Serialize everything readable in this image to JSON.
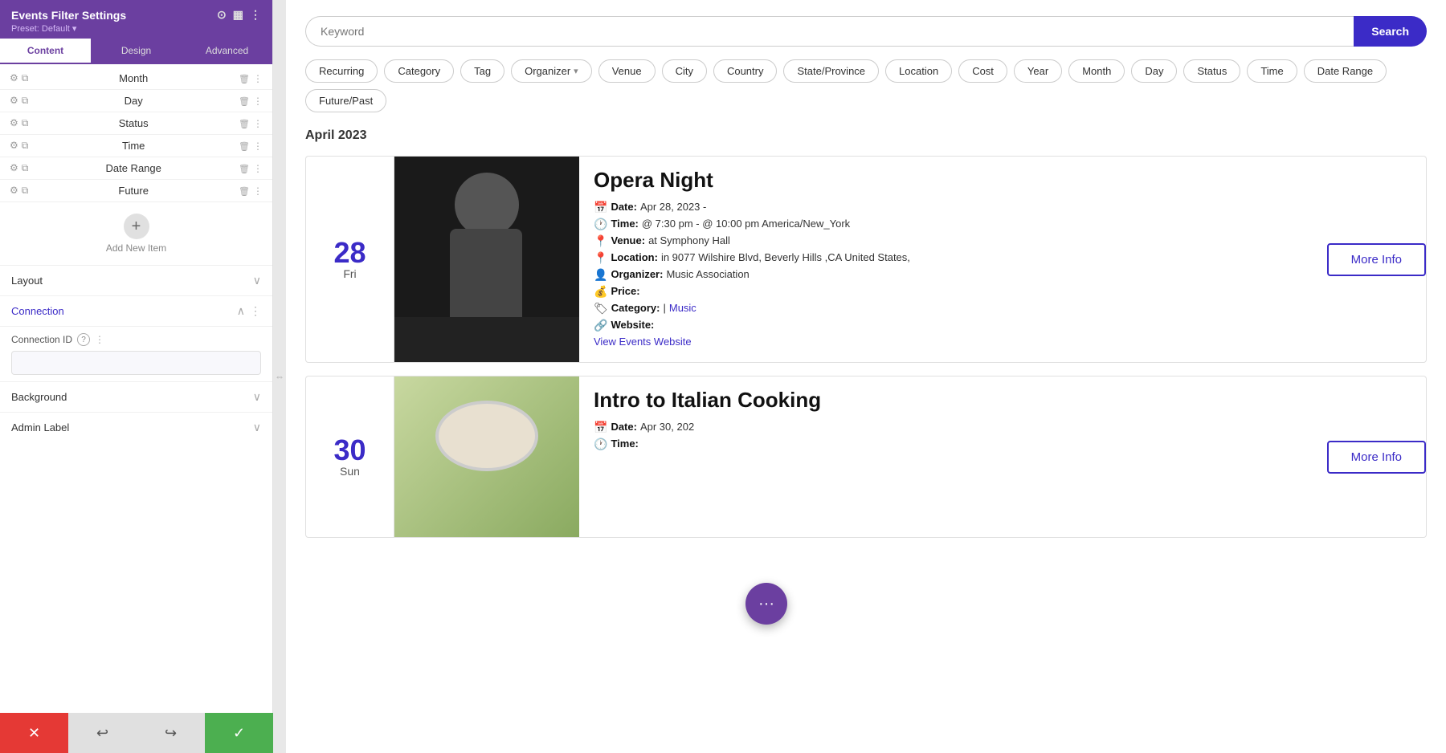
{
  "panel": {
    "title": "Events Filter Settings",
    "preset": "Preset: Default ▾",
    "tabs": [
      "Content",
      "Design",
      "Advanced"
    ],
    "active_tab": "Content",
    "filter_items": [
      {
        "name": "Month"
      },
      {
        "name": "Day"
      },
      {
        "name": "Status"
      },
      {
        "name": "Time"
      },
      {
        "name": "Date Range"
      },
      {
        "name": "Future"
      }
    ],
    "add_item_label": "Add New Item",
    "sections": {
      "layout": "Layout",
      "connection": "Connection",
      "connection_id_label": "Connection ID",
      "background": "Background",
      "admin_label": "Admin Label"
    }
  },
  "search": {
    "placeholder": "Keyword",
    "button_label": "Search"
  },
  "filter_pills": [
    {
      "label": "Recurring",
      "has_chevron": false
    },
    {
      "label": "Category",
      "has_chevron": false
    },
    {
      "label": "Tag",
      "has_chevron": false
    },
    {
      "label": "Organizer",
      "has_chevron": true
    },
    {
      "label": "Venue",
      "has_chevron": false
    },
    {
      "label": "City",
      "has_chevron": false
    },
    {
      "label": "Country",
      "has_chevron": false
    },
    {
      "label": "State/Province",
      "has_chevron": false
    },
    {
      "label": "Location",
      "has_chevron": false
    },
    {
      "label": "Cost",
      "has_chevron": false
    },
    {
      "label": "Year",
      "has_chevron": false
    },
    {
      "label": "Month",
      "has_chevron": false
    },
    {
      "label": "Day",
      "has_chevron": false
    },
    {
      "label": "Status",
      "has_chevron": false
    },
    {
      "label": "Time",
      "has_chevron": false
    },
    {
      "label": "Date Range",
      "has_chevron": false
    },
    {
      "label": "Future/Past",
      "has_chevron": false
    }
  ],
  "month_label": "April 2023",
  "events": [
    {
      "date_num": "28",
      "date_day": "Fri",
      "title": "Opera Night",
      "more_info_label": "More Info",
      "meta": {
        "date_label": "Date:",
        "date_value": "Apr 28, 2023 -",
        "time_label": "Time:",
        "time_value": "@ 7:30 pm - @ 10:00 pm America/New_York",
        "venue_label": "Venue:",
        "venue_value": "at Symphony Hall",
        "location_label": "Location:",
        "location_value": "in 9077 Wilshire Blvd, Beverly Hills ,CA United States,",
        "organizer_label": "Organizer:",
        "organizer_value": "Music Association",
        "price_label": "Price:",
        "price_value": "",
        "category_label": "Category:",
        "category_value": "| Music",
        "category_link": "Music",
        "website_label": "Website:",
        "website_link": "View Events Website"
      },
      "image_type": "opera"
    },
    {
      "date_num": "30",
      "date_day": "Sun",
      "title": "Intro to Italian Cooking",
      "more_info_label": "More Info",
      "meta": {
        "date_label": "Date:",
        "date_value": "Apr 30, 202",
        "time_label": "Time:",
        "time_value": ""
      },
      "image_type": "cooking"
    }
  ],
  "bottom_bar": {
    "cancel_icon": "✕",
    "undo_icon": "↩",
    "redo_icon": "↪",
    "confirm_icon": "✓"
  },
  "floating_orb": {
    "icon": "···"
  }
}
